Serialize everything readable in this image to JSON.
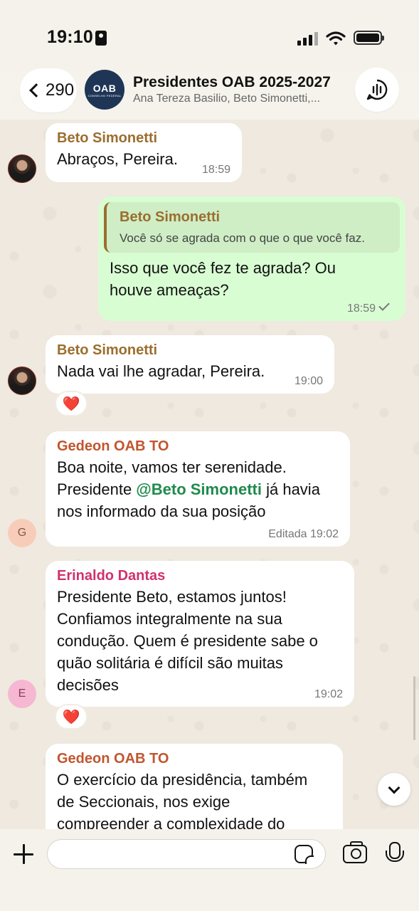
{
  "status_bar": {
    "time": "19:10"
  },
  "header": {
    "back_count": "290",
    "group_avatar_text": "OAB",
    "group_avatar_sub": "CONSELHO FEDERAL",
    "title": "Presidentes OAB 2025-2027",
    "subtitle": "Ana Tereza Basilio, Beto Simonetti,..."
  },
  "messages": [
    {
      "sender": "Beto Simonetti",
      "sender_color": "#9b6e2e",
      "text": "Abraços, Pereira.",
      "time": "18:59"
    },
    {
      "outgoing": true,
      "quote_name": "Beto Simonetti",
      "quote_text": "Você só se agrada com o que o que você faz.",
      "text_1": "Isso que você fez te agrada? Ou",
      "text_2": "houve ameaças?",
      "time": "18:59"
    },
    {
      "sender": "Beto Simonetti",
      "sender_color": "#9b6e2e",
      "text": "Nada vai lhe agradar, Pereira.",
      "time": "19:00",
      "reaction": "❤️"
    },
    {
      "sender": "Gedeon OAB TO",
      "sender_color": "#c0562f",
      "line_1": "Boa noite, vamos ter serenidade.",
      "line_2_pre": "Presidente ",
      "mention": "@Beto Simonetti",
      "line_2_post": " já havia",
      "line_3": "nos informado da sua posição",
      "time": "Editada 19:02",
      "avatar_letter": "G"
    },
    {
      "sender": "Erinaldo Dantas",
      "sender_color": "#d0316e",
      "line_1": "Presidente Beto, estamos juntos!",
      "line_2": "Confiamos integralmente na sua",
      "line_3": "condução. Quem é presidente sabe o",
      "line_4": "quão solitária é difícil são muitas",
      "line_5": "decisões",
      "time": "19:02",
      "avatar_letter": "E",
      "reaction": "❤️"
    },
    {
      "sender": "Gedeon OAB TO",
      "sender_color": "#c0562f",
      "line_1": "O exercício da presidência, também",
      "line_2": "de Seccionais,  nos exige",
      "line_3": "compreender a complexidade do"
    }
  ],
  "input": {
    "placeholder": ""
  },
  "icons": [
    "back-chevron-icon",
    "call-waveform-icon",
    "plus-icon",
    "sticker-icon",
    "camera-icon",
    "mic-icon",
    "chevron-down-icon",
    "heart-icon"
  ]
}
